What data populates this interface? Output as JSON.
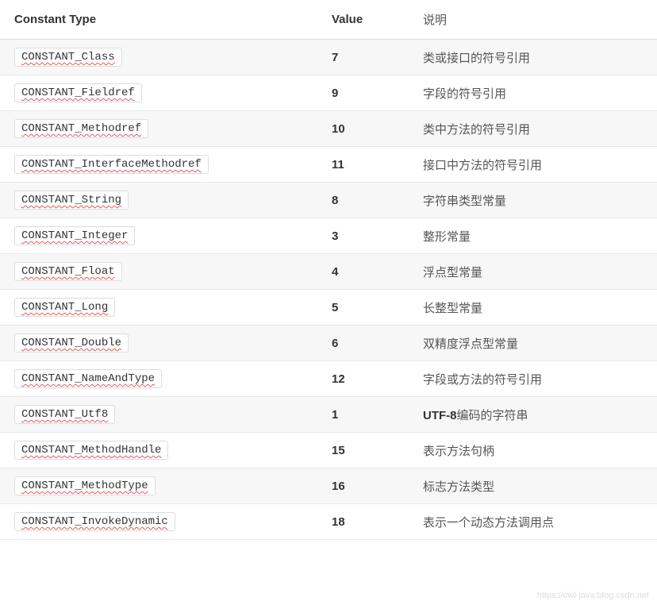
{
  "headers": {
    "col1": "Constant Type",
    "col2": "Value",
    "col3": "说明"
  },
  "rows": [
    {
      "type": "CONSTANT_Class",
      "value": "7",
      "desc": "类或接口的符号引用"
    },
    {
      "type": "CONSTANT_Fieldref",
      "value": "9",
      "desc": "字段的符号引用"
    },
    {
      "type": "CONSTANT_Methodref",
      "value": "10",
      "desc": "类中方法的符号引用"
    },
    {
      "type": "CONSTANT_InterfaceMethodref",
      "value": "11",
      "desc": "接口中方法的符号引用"
    },
    {
      "type": "CONSTANT_String",
      "value": "8",
      "desc": "字符串类型常量"
    },
    {
      "type": "CONSTANT_Integer",
      "value": "3",
      "desc": "整形常量"
    },
    {
      "type": "CONSTANT_Float",
      "value": "4",
      "desc": "浮点型常量"
    },
    {
      "type": "CONSTANT_Long",
      "value": "5",
      "desc": "长整型常量"
    },
    {
      "type": "CONSTANT_Double",
      "value": "6",
      "desc": "双精度浮点型常量"
    },
    {
      "type": "CONSTANT_NameAndType",
      "value": "12",
      "desc": "字段或方法的符号引用"
    },
    {
      "type": "CONSTANT_Utf8",
      "value": "1",
      "desc_prefix": "UTF-8",
      "desc_suffix": "编码的字符串",
      "utf8": true
    },
    {
      "type": "CONSTANT_MethodHandle",
      "value": "15",
      "desc": "表示方法句柄"
    },
    {
      "type": "CONSTANT_MethodType",
      "value": "16",
      "desc": "标志方法类型"
    },
    {
      "type": "CONSTANT_InvokeDynamic",
      "value": "18",
      "desc": "表示一个动态方法调用点"
    }
  ],
  "watermark": "https://cwl-java.blog.csdn.net"
}
